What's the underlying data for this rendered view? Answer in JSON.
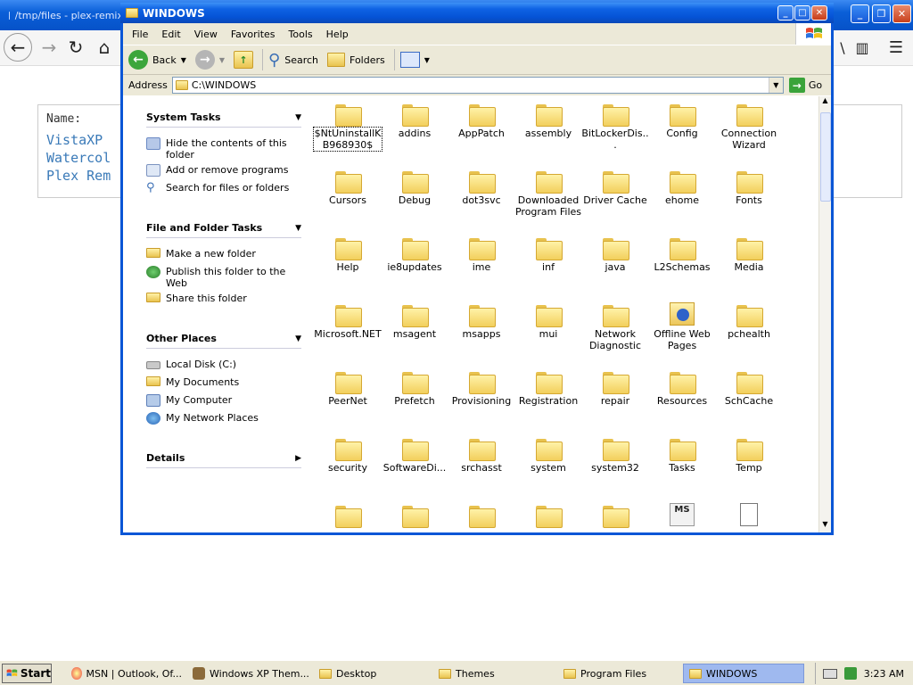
{
  "browser": {
    "tab_title": "/tmp/files - plex-remix",
    "name_label": "Name:",
    "file_names": [
      "VistaXP",
      "Watercol",
      "Plex Rem"
    ]
  },
  "explorer": {
    "title": "WINDOWS",
    "menu": [
      "File",
      "Edit",
      "View",
      "Favorites",
      "Tools",
      "Help"
    ],
    "toolbar": {
      "back": "Back",
      "search": "Search",
      "folders": "Folders"
    },
    "address_label": "Address",
    "address_value": "C:\\WINDOWS",
    "go_label": "Go",
    "system_tasks": {
      "title": "System Tasks",
      "items": [
        "Hide the contents of this folder",
        "Add or remove programs",
        "Search for files or folders"
      ]
    },
    "file_folder_tasks": {
      "title": "File and Folder Tasks",
      "items": [
        "Make a new folder",
        "Publish this folder to the Web",
        "Share this folder"
      ]
    },
    "other_places": {
      "title": "Other Places",
      "items": [
        "Local Disk (C:)",
        "My Documents",
        "My Computer",
        "My Network Places"
      ]
    },
    "details": {
      "title": "Details"
    },
    "items": [
      "$NtUninstallKB968930$",
      "addins",
      "AppPatch",
      "assembly",
      "BitLockerDis...",
      "Config",
      "Connection Wizard",
      "Cursors",
      "Debug",
      "dot3svc",
      "Downloaded Program Files",
      "Driver Cache",
      "ehome",
      "Fonts",
      "Help",
      "ie8updates",
      "ime",
      "inf",
      "java",
      "L2Schemas",
      "Media",
      "Microsoft.NET",
      "msagent",
      "msapps",
      "mui",
      "Network Diagnostic",
      "Offline Web Pages",
      "pchealth",
      "PeerNet",
      "Prefetch",
      "Provisioning",
      "Registration",
      "repair",
      "Resources",
      "SchCache",
      "security",
      "SoftwareDi...",
      "srchasst",
      "system",
      "system32",
      "Tasks",
      "Temp",
      "",
      "",
      "",
      "",
      "",
      "",
      ""
    ]
  },
  "taskbar": {
    "start": "Start",
    "buttons": [
      "MSN | Outlook, Of...",
      "Windows XP Them...",
      "Desktop",
      "Themes",
      "Program Files",
      "WINDOWS"
    ],
    "clock": "3:23 AM"
  }
}
